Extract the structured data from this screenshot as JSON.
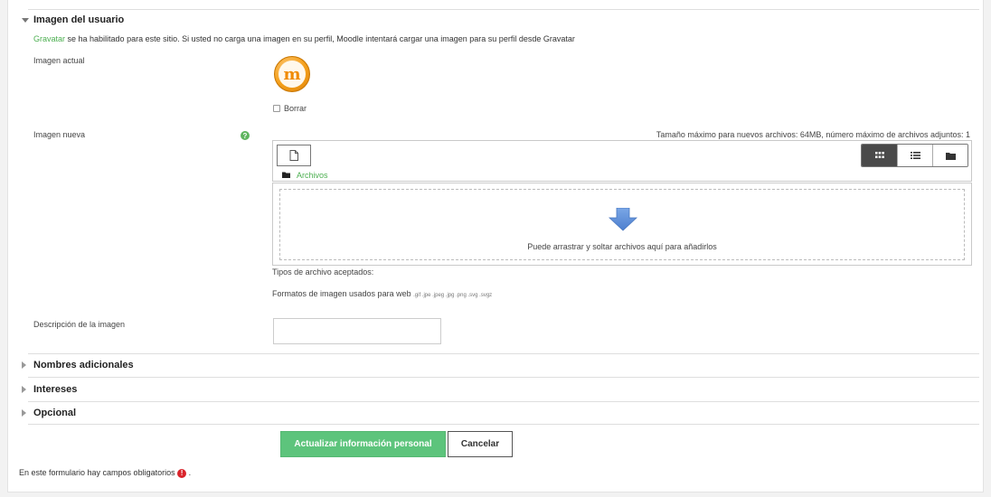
{
  "sections": {
    "user_image": {
      "title": "Imagen del usuario",
      "gravatar_link": "Gravatar",
      "gravatar_notice": " se ha habilitado para este sitio. Si usted no carga una imagen en su perfil, Moodle intentará cargar una imagen para su perfil desde Gravatar",
      "current_image_label": "Imagen actual",
      "delete_label": "Borrar",
      "new_image_label": "Imagen nueva",
      "max_size_notice": "Tamaño máximo para nuevos archivos: 64MB, número máximo de archivos adjuntos: 1",
      "files_path": "Archivos",
      "dropzone_text": "Puede arrastrar y soltar archivos aquí para añadirlos",
      "accepted_types_label": "Tipos de archivo aceptados:",
      "formats_label": "Formatos de imagen usados para web",
      "formats_ext": ".gif .jpe .jpeg .jpg .png .svg .svgz",
      "description_label": "Descripción de la imagen",
      "description_value": ""
    },
    "collapsed": [
      "Nombres adicionales",
      "Intereses",
      "Opcional"
    ]
  },
  "buttons": {
    "submit": "Actualizar información personal",
    "cancel": "Cancelar"
  },
  "footer": {
    "required_notice": "En este formulario hay campos obligatorios",
    "required_suffix": "."
  },
  "icons": {
    "avatar_letter": "m",
    "help": "?",
    "required": "!"
  },
  "colors": {
    "accent_green": "#5dc47c",
    "link_green": "#4caf50",
    "required_red": "#d9242b",
    "dropzone_arrow": "#5b8ed6"
  }
}
